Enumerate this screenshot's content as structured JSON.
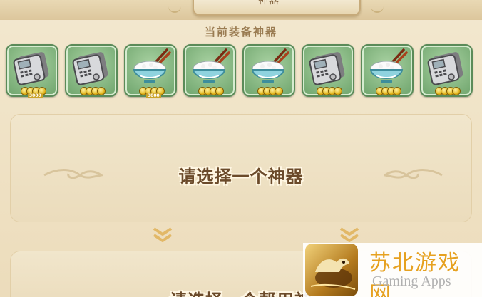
{
  "header": {
    "tab_label": "神器"
  },
  "equipped": {
    "title": "当前装备神器",
    "slots": [
      {
        "icon": "phone-icon",
        "rarity_label": "3000"
      },
      {
        "icon": "phone-icon",
        "rarity_label": ""
      },
      {
        "icon": "rice-bowl-icon",
        "rarity_label": "3000"
      },
      {
        "icon": "rice-bowl-icon",
        "rarity_label": ""
      },
      {
        "icon": "rice-bowl-icon",
        "rarity_label": ""
      },
      {
        "icon": "phone-icon",
        "rarity_label": ""
      },
      {
        "icon": "rice-bowl-icon",
        "rarity_label": ""
      },
      {
        "icon": "phone-icon",
        "rarity_label": ""
      }
    ]
  },
  "select_prompt": "请选择一个神器",
  "select_prompt_2": "请选择一个帮用神",
  "watermark": {
    "name": "苏北游戏网",
    "subtitle": "Gaming Apps"
  },
  "colors": {
    "slot_green": "#7fb07a",
    "panel": "#efe2c3",
    "text_brown": "#6b4a2a",
    "gold": "#e6a120"
  }
}
